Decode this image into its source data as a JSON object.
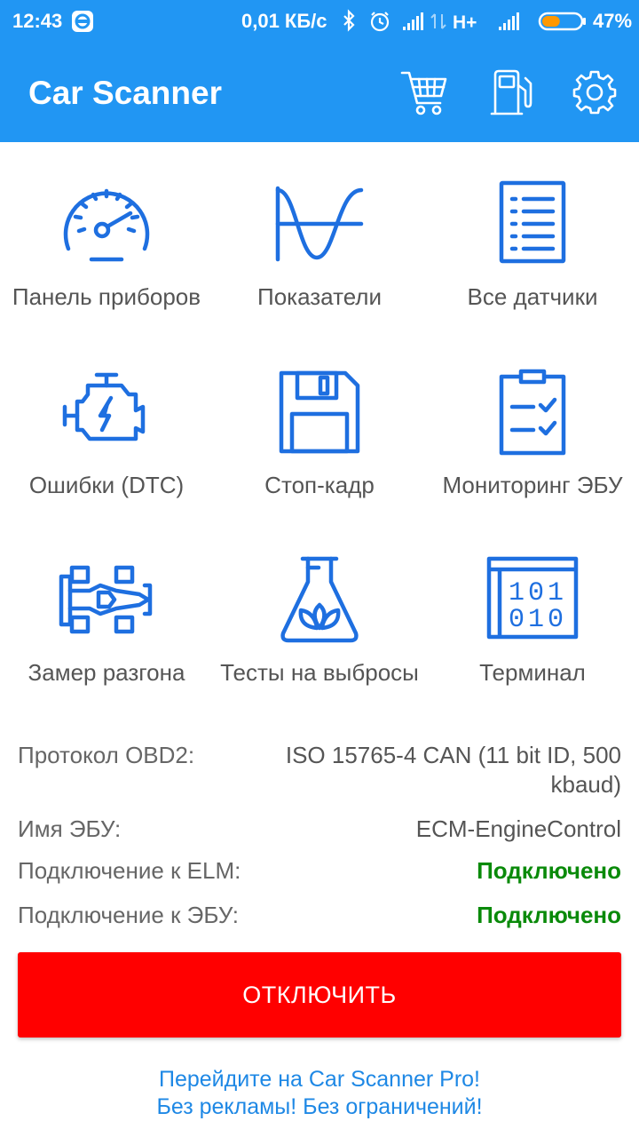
{
  "status_bar": {
    "time": "12:43",
    "network_speed": "0,01 КБ/с",
    "network_type": "H+",
    "battery_percent": "47%",
    "battery_level": 0.47
  },
  "app_bar": {
    "title": "Car Scanner",
    "actions": [
      "cart-icon",
      "fuel-pump-icon",
      "gear-icon"
    ]
  },
  "menu": [
    {
      "label": "Панель приборов",
      "icon": "speedometer-icon"
    },
    {
      "label": "Показатели",
      "icon": "waveform-icon"
    },
    {
      "label": "Все датчики",
      "icon": "list-icon"
    },
    {
      "label": "Ошибки (DTC)",
      "icon": "engine-icon"
    },
    {
      "label": "Стоп-кадр",
      "icon": "floppy-disk-icon"
    },
    {
      "label": "Мониторинг ЭБУ",
      "icon": "clipboard-check-icon"
    },
    {
      "label": "Замер разгона",
      "icon": "race-car-icon"
    },
    {
      "label": "Тесты на выбросы",
      "icon": "flask-leaf-icon"
    },
    {
      "label": "Терминал",
      "icon": "binary-terminal-icon"
    }
  ],
  "info": {
    "protocol_label": "Протокол OBD2:",
    "protocol_value_line1": "ISO 15765-4 CAN (11 bit ID, 500",
    "protocol_value_line2": "kbaud)",
    "ecu_name_label": "Имя ЭБУ:",
    "ecu_name_value": "ECM-EngineControl",
    "elm_label": "Подключение к ELM:",
    "elm_value": "Подключено",
    "ecu_conn_label": "Подключение к ЭБУ:",
    "ecu_conn_value": "Подключено"
  },
  "disconnect_label": "ОТКЛЮЧИТЬ",
  "promo": {
    "line1": "Перейдите на Car Scanner Pro!",
    "line2": "Без рекламы! Без ограничений!"
  },
  "colors": {
    "primary": "#2196f3",
    "icon_blue": "#1e6fe0",
    "danger": "#ff0000",
    "success": "#0a8a0a",
    "link": "#1e88e5"
  }
}
